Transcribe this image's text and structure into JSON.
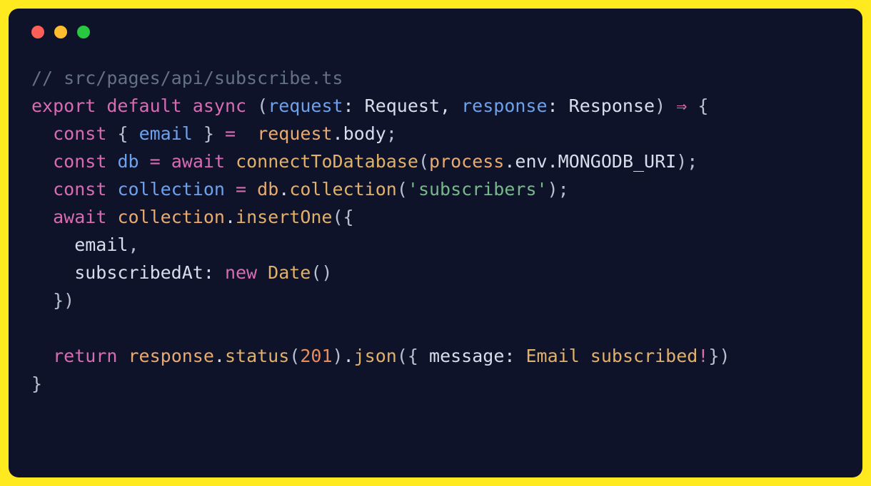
{
  "code": {
    "lines": [
      [
        {
          "t": "// src/pages/api/subscribe.ts",
          "c": "c-comment"
        }
      ],
      [
        {
          "t": "export",
          "c": "c-keyword"
        },
        {
          "t": " ",
          "c": "c-ident"
        },
        {
          "t": "default",
          "c": "c-keyword"
        },
        {
          "t": " ",
          "c": "c-ident"
        },
        {
          "t": "async",
          "c": "c-keyword"
        },
        {
          "t": " ",
          "c": "c-ident"
        },
        {
          "t": "(",
          "c": "c-basepunct"
        },
        {
          "t": "request",
          "c": "c-param"
        },
        {
          "t": ": ",
          "c": "c-punct"
        },
        {
          "t": "Request",
          "c": "c-type"
        },
        {
          "t": ", ",
          "c": "c-punct"
        },
        {
          "t": "response",
          "c": "c-param"
        },
        {
          "t": ": ",
          "c": "c-punct"
        },
        {
          "t": "Response",
          "c": "c-type"
        },
        {
          "t": ")",
          "c": "c-basepunct"
        },
        {
          "t": " ",
          "c": "c-ident"
        },
        {
          "t": "⇒",
          "c": "c-keyword"
        },
        {
          "t": " ",
          "c": "c-ident"
        },
        {
          "t": "{",
          "c": "c-basepunct"
        }
      ],
      [
        {
          "t": "  ",
          "c": "c-ident"
        },
        {
          "t": "const",
          "c": "c-keyword"
        },
        {
          "t": " ",
          "c": "c-ident"
        },
        {
          "t": "{",
          "c": "c-basepunct"
        },
        {
          "t": " ",
          "c": "c-ident"
        },
        {
          "t": "email",
          "c": "c-param"
        },
        {
          "t": " ",
          "c": "c-ident"
        },
        {
          "t": "}",
          "c": "c-basepunct"
        },
        {
          "t": " ",
          "c": "c-ident"
        },
        {
          "t": "=",
          "c": "c-keyword"
        },
        {
          "t": "  ",
          "c": "c-ident"
        },
        {
          "t": "request",
          "c": "c-prop"
        },
        {
          "t": ".",
          "c": "c-punct"
        },
        {
          "t": "body",
          "c": "c-ident"
        },
        {
          "t": ";",
          "c": "c-basepunct"
        }
      ],
      [
        {
          "t": "  ",
          "c": "c-ident"
        },
        {
          "t": "const",
          "c": "c-keyword"
        },
        {
          "t": " ",
          "c": "c-ident"
        },
        {
          "t": "db",
          "c": "c-param"
        },
        {
          "t": " ",
          "c": "c-ident"
        },
        {
          "t": "=",
          "c": "c-keyword"
        },
        {
          "t": " ",
          "c": "c-ident"
        },
        {
          "t": "await",
          "c": "c-keyword"
        },
        {
          "t": " ",
          "c": "c-ident"
        },
        {
          "t": "connectToDatabase",
          "c": "c-func"
        },
        {
          "t": "(",
          "c": "c-basepunct"
        },
        {
          "t": "process",
          "c": "c-prop"
        },
        {
          "t": ".",
          "c": "c-punct"
        },
        {
          "t": "env",
          "c": "c-ident"
        },
        {
          "t": ".",
          "c": "c-punct"
        },
        {
          "t": "MONGODB_URI",
          "c": "c-ident"
        },
        {
          "t": ")",
          "c": "c-basepunct"
        },
        {
          "t": ";",
          "c": "c-basepunct"
        }
      ],
      [
        {
          "t": "  ",
          "c": "c-ident"
        },
        {
          "t": "const",
          "c": "c-keyword"
        },
        {
          "t": " ",
          "c": "c-ident"
        },
        {
          "t": "collection",
          "c": "c-param"
        },
        {
          "t": " ",
          "c": "c-ident"
        },
        {
          "t": "=",
          "c": "c-keyword"
        },
        {
          "t": " ",
          "c": "c-ident"
        },
        {
          "t": "db",
          "c": "c-prop"
        },
        {
          "t": ".",
          "c": "c-punct"
        },
        {
          "t": "collection",
          "c": "c-func"
        },
        {
          "t": "(",
          "c": "c-basepunct"
        },
        {
          "t": "'subscribers'",
          "c": "c-string"
        },
        {
          "t": ")",
          "c": "c-basepunct"
        },
        {
          "t": ";",
          "c": "c-basepunct"
        }
      ],
      [
        {
          "t": "  ",
          "c": "c-ident"
        },
        {
          "t": "await",
          "c": "c-keyword"
        },
        {
          "t": " ",
          "c": "c-ident"
        },
        {
          "t": "collection",
          "c": "c-prop"
        },
        {
          "t": ".",
          "c": "c-punct"
        },
        {
          "t": "insertOne",
          "c": "c-func"
        },
        {
          "t": "(",
          "c": "c-basepunct"
        },
        {
          "t": "{",
          "c": "c-basepunct"
        }
      ],
      [
        {
          "t": "    email",
          "c": "c-ident"
        },
        {
          "t": ",",
          "c": "c-basepunct"
        }
      ],
      [
        {
          "t": "    subscribedAt",
          "c": "c-ident"
        },
        {
          "t": ": ",
          "c": "c-punct"
        },
        {
          "t": "new",
          "c": "c-keyword"
        },
        {
          "t": " ",
          "c": "c-ident"
        },
        {
          "t": "Date",
          "c": "c-func"
        },
        {
          "t": "()",
          "c": "c-basepunct"
        }
      ],
      [
        {
          "t": "  ",
          "c": "c-ident"
        },
        {
          "t": "})",
          "c": "c-basepunct"
        }
      ],
      [
        {
          "t": " ",
          "c": "c-ident"
        }
      ],
      [
        {
          "t": "  ",
          "c": "c-ident"
        },
        {
          "t": "return",
          "c": "c-keyword"
        },
        {
          "t": " ",
          "c": "c-ident"
        },
        {
          "t": "response",
          "c": "c-prop"
        },
        {
          "t": ".",
          "c": "c-punct"
        },
        {
          "t": "status",
          "c": "c-func"
        },
        {
          "t": "(",
          "c": "c-basepunct"
        },
        {
          "t": "201",
          "c": "c-number"
        },
        {
          "t": ")",
          "c": "c-basepunct"
        },
        {
          "t": ".",
          "c": "c-punct"
        },
        {
          "t": "json",
          "c": "c-func"
        },
        {
          "t": "(",
          "c": "c-basepunct"
        },
        {
          "t": "{",
          "c": "c-basepunct"
        },
        {
          "t": " message",
          "c": "c-ident"
        },
        {
          "t": ": ",
          "c": "c-punct"
        },
        {
          "t": "Email subscribed",
          "c": "c-func"
        },
        {
          "t": "!",
          "c": "c-keyword"
        },
        {
          "t": "})",
          "c": "c-basepunct"
        }
      ],
      [
        {
          "t": "}",
          "c": "c-basepunct"
        }
      ]
    ]
  }
}
